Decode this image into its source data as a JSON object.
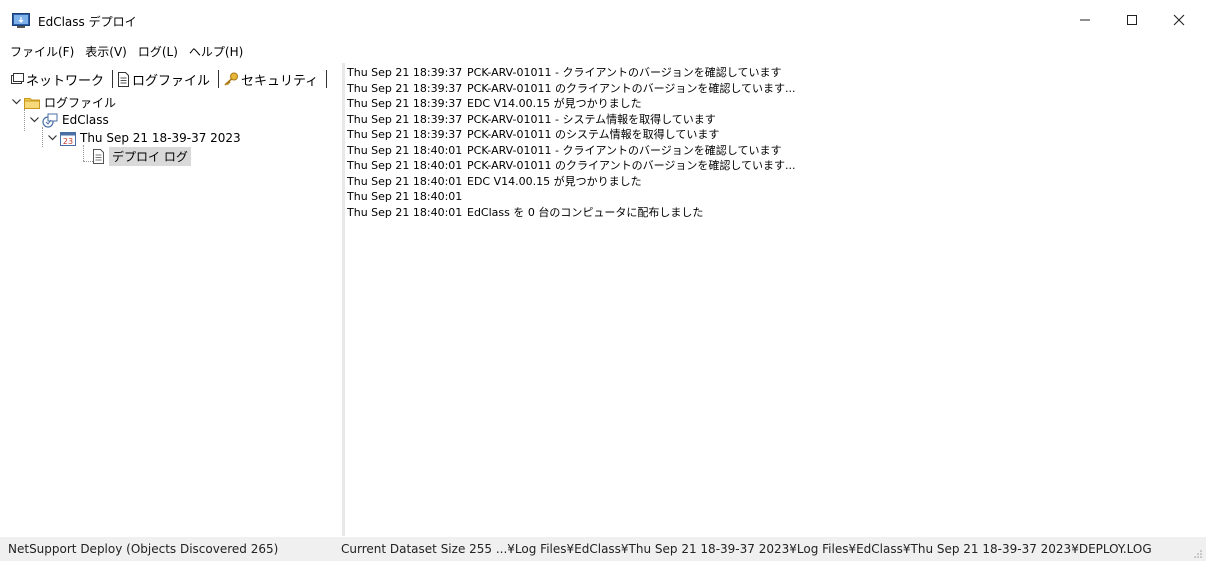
{
  "window": {
    "title": "EdClass デプロイ"
  },
  "menu": [
    "ファイル(F)",
    "表示(V)",
    "ログ(L)",
    "ヘルプ(H)"
  ],
  "tabs": [
    {
      "label": "ネットワーク",
      "icon": "network-icon"
    },
    {
      "label": "ログファイル",
      "icon": "document-icon"
    },
    {
      "label": "セキュリティ",
      "icon": "key-icon"
    }
  ],
  "tree": {
    "root": {
      "label": "ログファイル",
      "icon": "folder-icon"
    },
    "app": {
      "label": "EdClass",
      "icon": "app-icon"
    },
    "session": {
      "label": "Thu Sep 21 18-39-37 2023",
      "icon": "calendar-icon",
      "calendar_day": "23"
    },
    "log": {
      "label": "デプロイ ログ",
      "icon": "document-icon"
    }
  },
  "log": [
    {
      "ts": "Thu Sep 21 18:39:37",
      "msg": "PCK-ARV-01011 - クライアントのバージョンを確認しています"
    },
    {
      "ts": "Thu Sep 21 18:39:37",
      "msg": "PCK-ARV-01011 のクライアントのバージョンを確認しています..."
    },
    {
      "ts": "Thu Sep 21 18:39:37",
      "msg": "EDC V14.00.15 が見つかりました"
    },
    {
      "ts": "Thu Sep 21 18:39:37",
      "msg": "PCK-ARV-01011 - システム情報を取得しています"
    },
    {
      "ts": "Thu Sep 21 18:39:37",
      "msg": "PCK-ARV-01011 のシステム情報を取得しています"
    },
    {
      "ts": "Thu Sep 21 18:40:01",
      "msg": "PCK-ARV-01011 - クライアントのバージョンを確認しています"
    },
    {
      "ts": "Thu Sep 21 18:40:01",
      "msg": "PCK-ARV-01011 のクライアントのバージョンを確認しています..."
    },
    {
      "ts": "Thu Sep 21 18:40:01",
      "msg": "EDC V14.00.15 が見つかりました"
    },
    {
      "ts": "Thu Sep 21 18:40:01",
      "msg": ""
    },
    {
      "ts": "Thu Sep 21 18:40:01",
      "msg": "EdClass を 0 台のコンピュータに配布しました"
    }
  ],
  "status": {
    "left": "NetSupport Deploy (Objects Discovered 265)",
    "right": "Current Dataset Size 255 ...¥Log Files¥EdClass¥Thu Sep 21 18-39-37 2023¥Log Files¥EdClass¥Thu Sep 21 18-39-37 2023¥DEPLOY.LOG"
  },
  "colors": {
    "folder": "#f2c94c",
    "selection": "#d9d9d9",
    "statusbar": "#f0f0f0"
  }
}
